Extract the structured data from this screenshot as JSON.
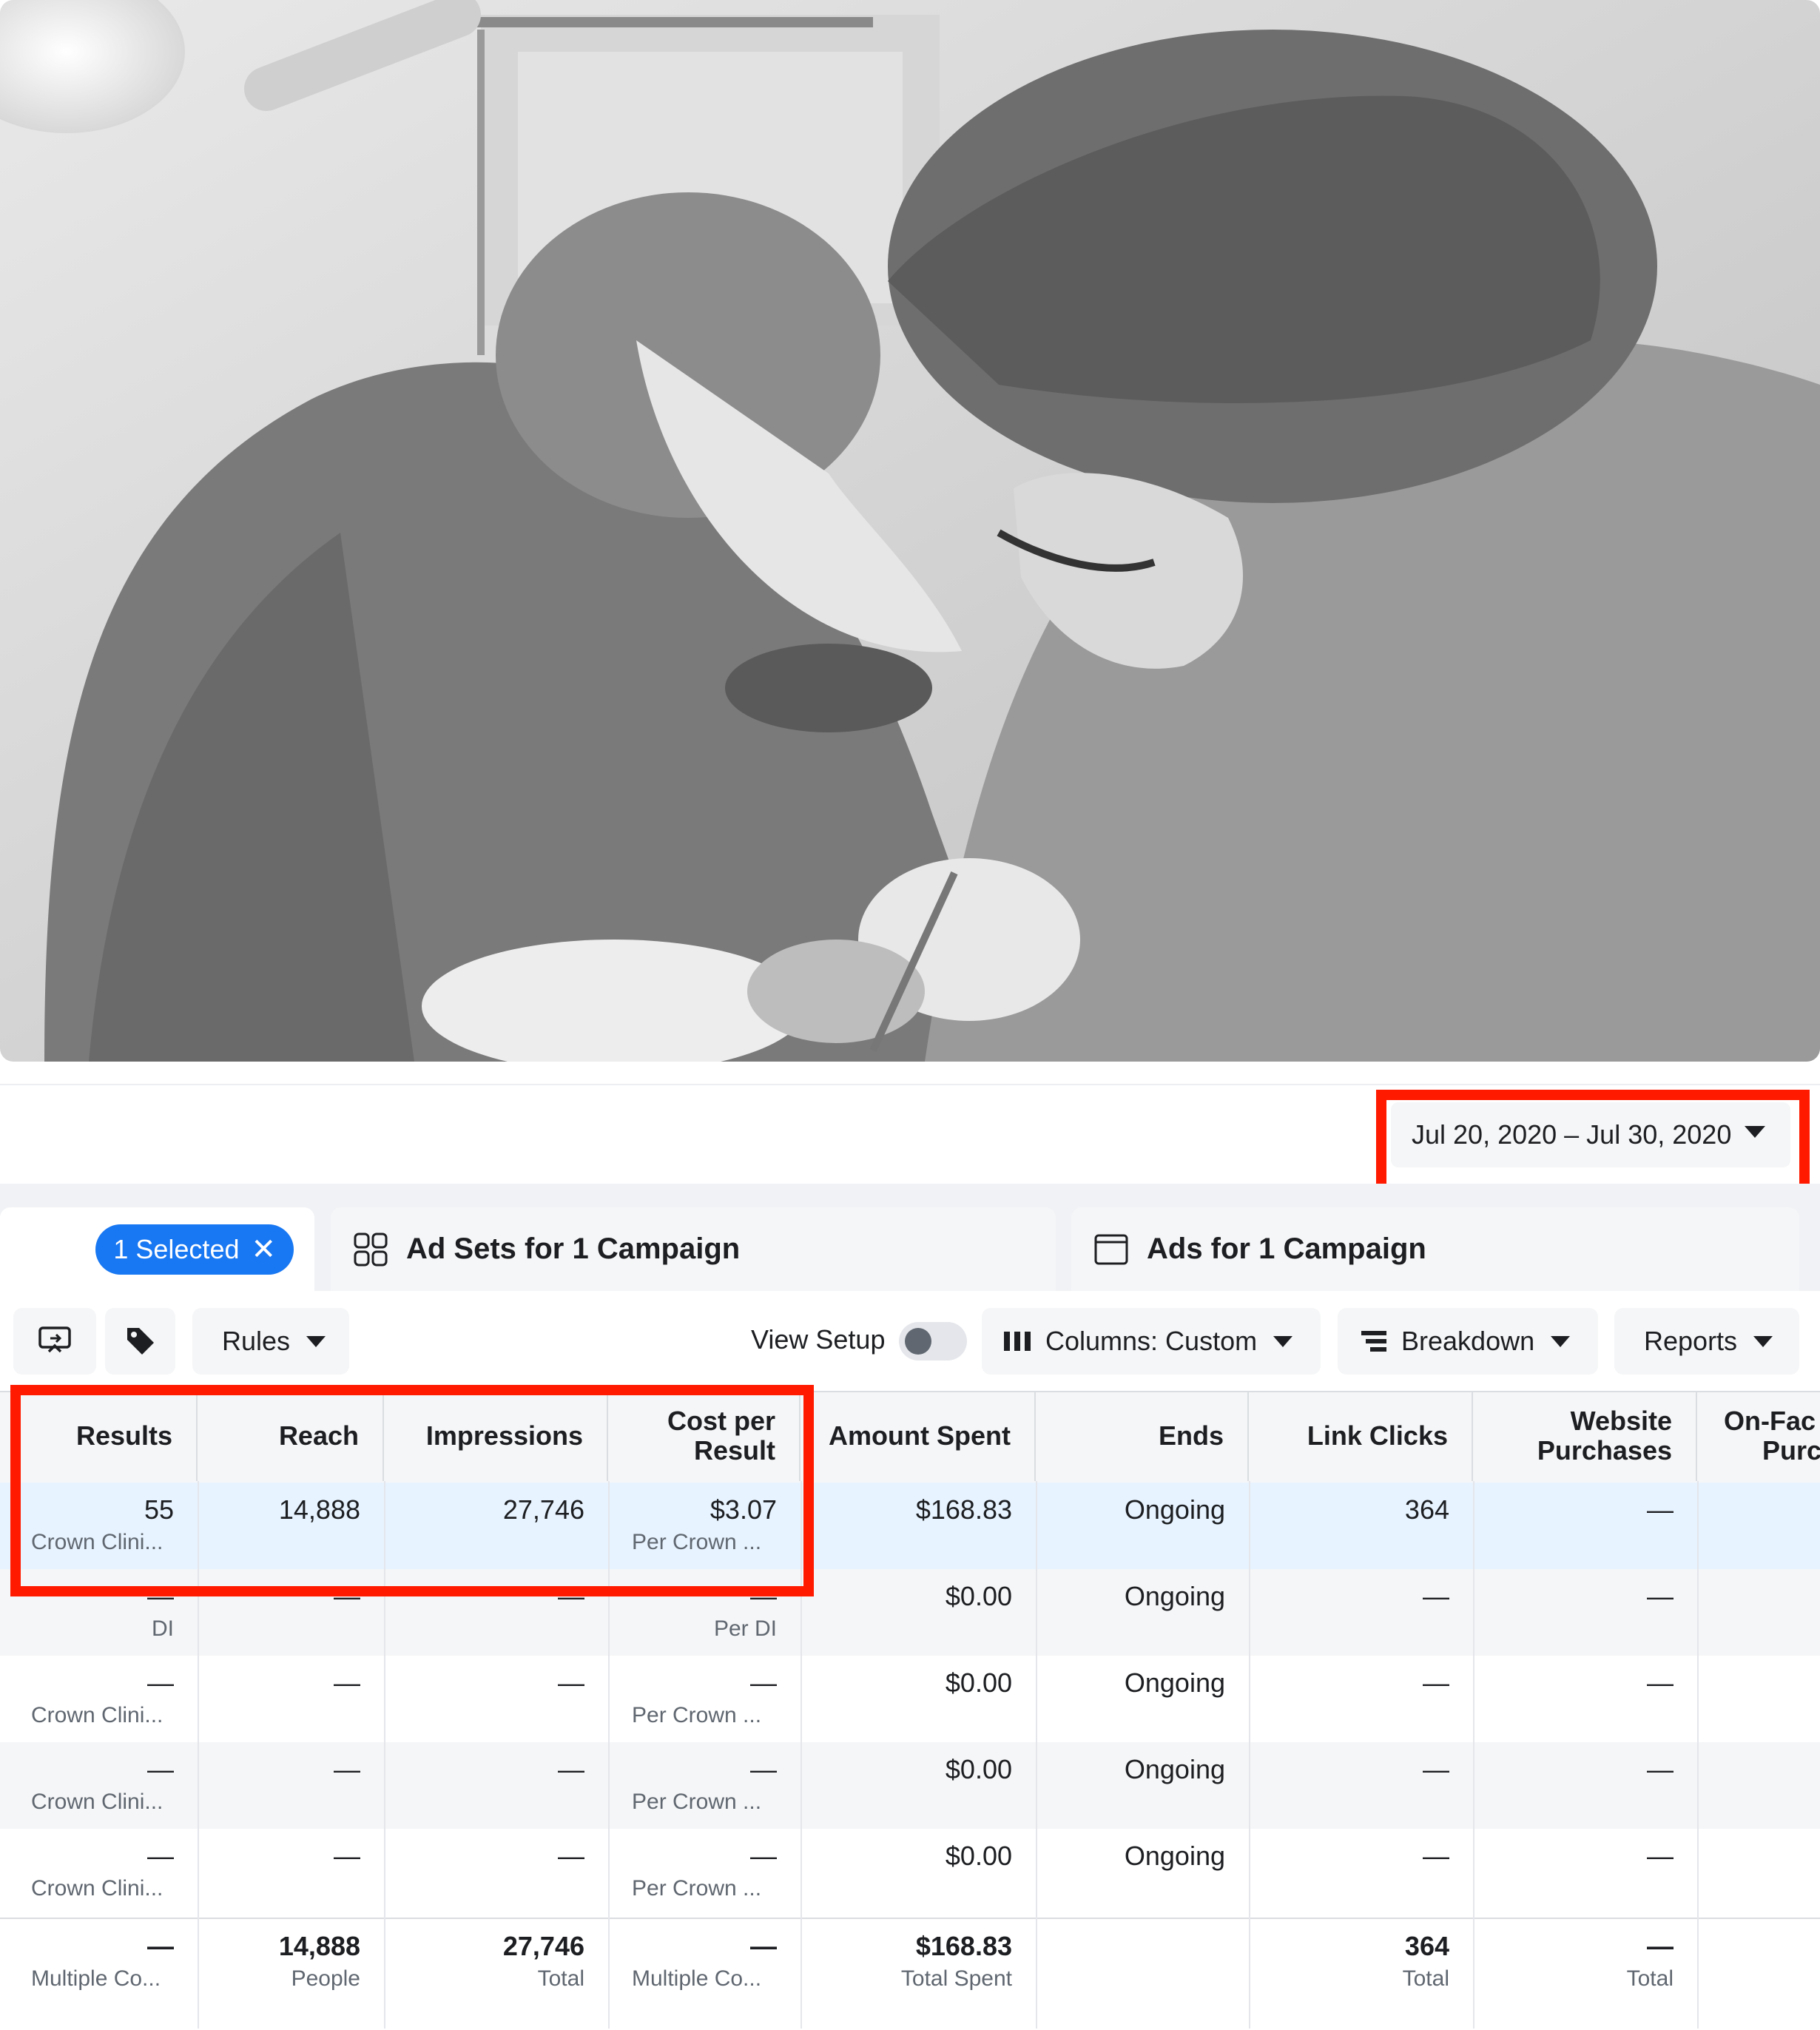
{
  "date_range": {
    "label": "Jul 20, 2020 – Jul 30, 2020"
  },
  "tabs": {
    "selected_label": "1 Selected",
    "ad_sets_label": "Ad Sets for 1 Campaign",
    "ads_label": "Ads for 1 Campaign"
  },
  "toolbar": {
    "rules_label": "Rules",
    "view_setup_label": "View Setup",
    "columns_label": "Columns: Custom",
    "breakdown_label": "Breakdown",
    "reports_label": "Reports"
  },
  "table": {
    "headers": {
      "results": "Results",
      "reach": "Reach",
      "impressions": "Impressions",
      "cost_1": "Cost per",
      "cost_2": "Result",
      "amount_spent": "Amount Spent",
      "ends": "Ends",
      "link_clicks": "Link Clicks",
      "website_1": "Website",
      "website_2": "Purchases",
      "onfac_1": "On-Fac",
      "onfac_2": "Purc"
    },
    "rows": [
      {
        "results": "55",
        "results_sub": "Crown Clini...",
        "reach": "14,888",
        "impressions": "27,746",
        "cost": "$3.07",
        "cost_sub": "Per Crown ...",
        "amount": "$168.83",
        "ends": "Ongoing",
        "clicks": "364",
        "purchases": "—"
      },
      {
        "results": "—",
        "results_sub": "DI",
        "reach": "—",
        "impressions": "—",
        "cost": "—",
        "cost_sub": "Per DI",
        "amount": "$0.00",
        "ends": "Ongoing",
        "clicks": "—",
        "purchases": "—"
      },
      {
        "results": "—",
        "results_sub": "Crown Clini...",
        "reach": "—",
        "impressions": "—",
        "cost": "—",
        "cost_sub": "Per Crown ...",
        "amount": "$0.00",
        "ends": "Ongoing",
        "clicks": "—",
        "purchases": "—"
      },
      {
        "results": "—",
        "results_sub": "Crown Clini...",
        "reach": "—",
        "impressions": "—",
        "cost": "—",
        "cost_sub": "Per Crown ...",
        "amount": "$0.00",
        "ends": "Ongoing",
        "clicks": "—",
        "purchases": "—"
      },
      {
        "results": "—",
        "results_sub": "Crown Clini...",
        "reach": "—",
        "impressions": "—",
        "cost": "—",
        "cost_sub": "Per Crown ...",
        "amount": "$0.00",
        "ends": "Ongoing",
        "clicks": "—",
        "purchases": "—"
      }
    ],
    "totals": {
      "results": "—",
      "results_sub": "Multiple Co...",
      "reach": "14,888",
      "reach_sub": "People",
      "impressions": "27,746",
      "impressions_sub": "Total",
      "cost": "—",
      "cost_sub": "Multiple Co...",
      "amount": "$168.83",
      "amount_sub": "Total Spent",
      "clicks": "364",
      "clicks_sub": "Total",
      "purchases": "—",
      "purchases_sub": "Total"
    }
  },
  "colors": {
    "highlight": "#ff1a00",
    "accent": "#1877f2",
    "selected_row": "#e7f3ff"
  }
}
